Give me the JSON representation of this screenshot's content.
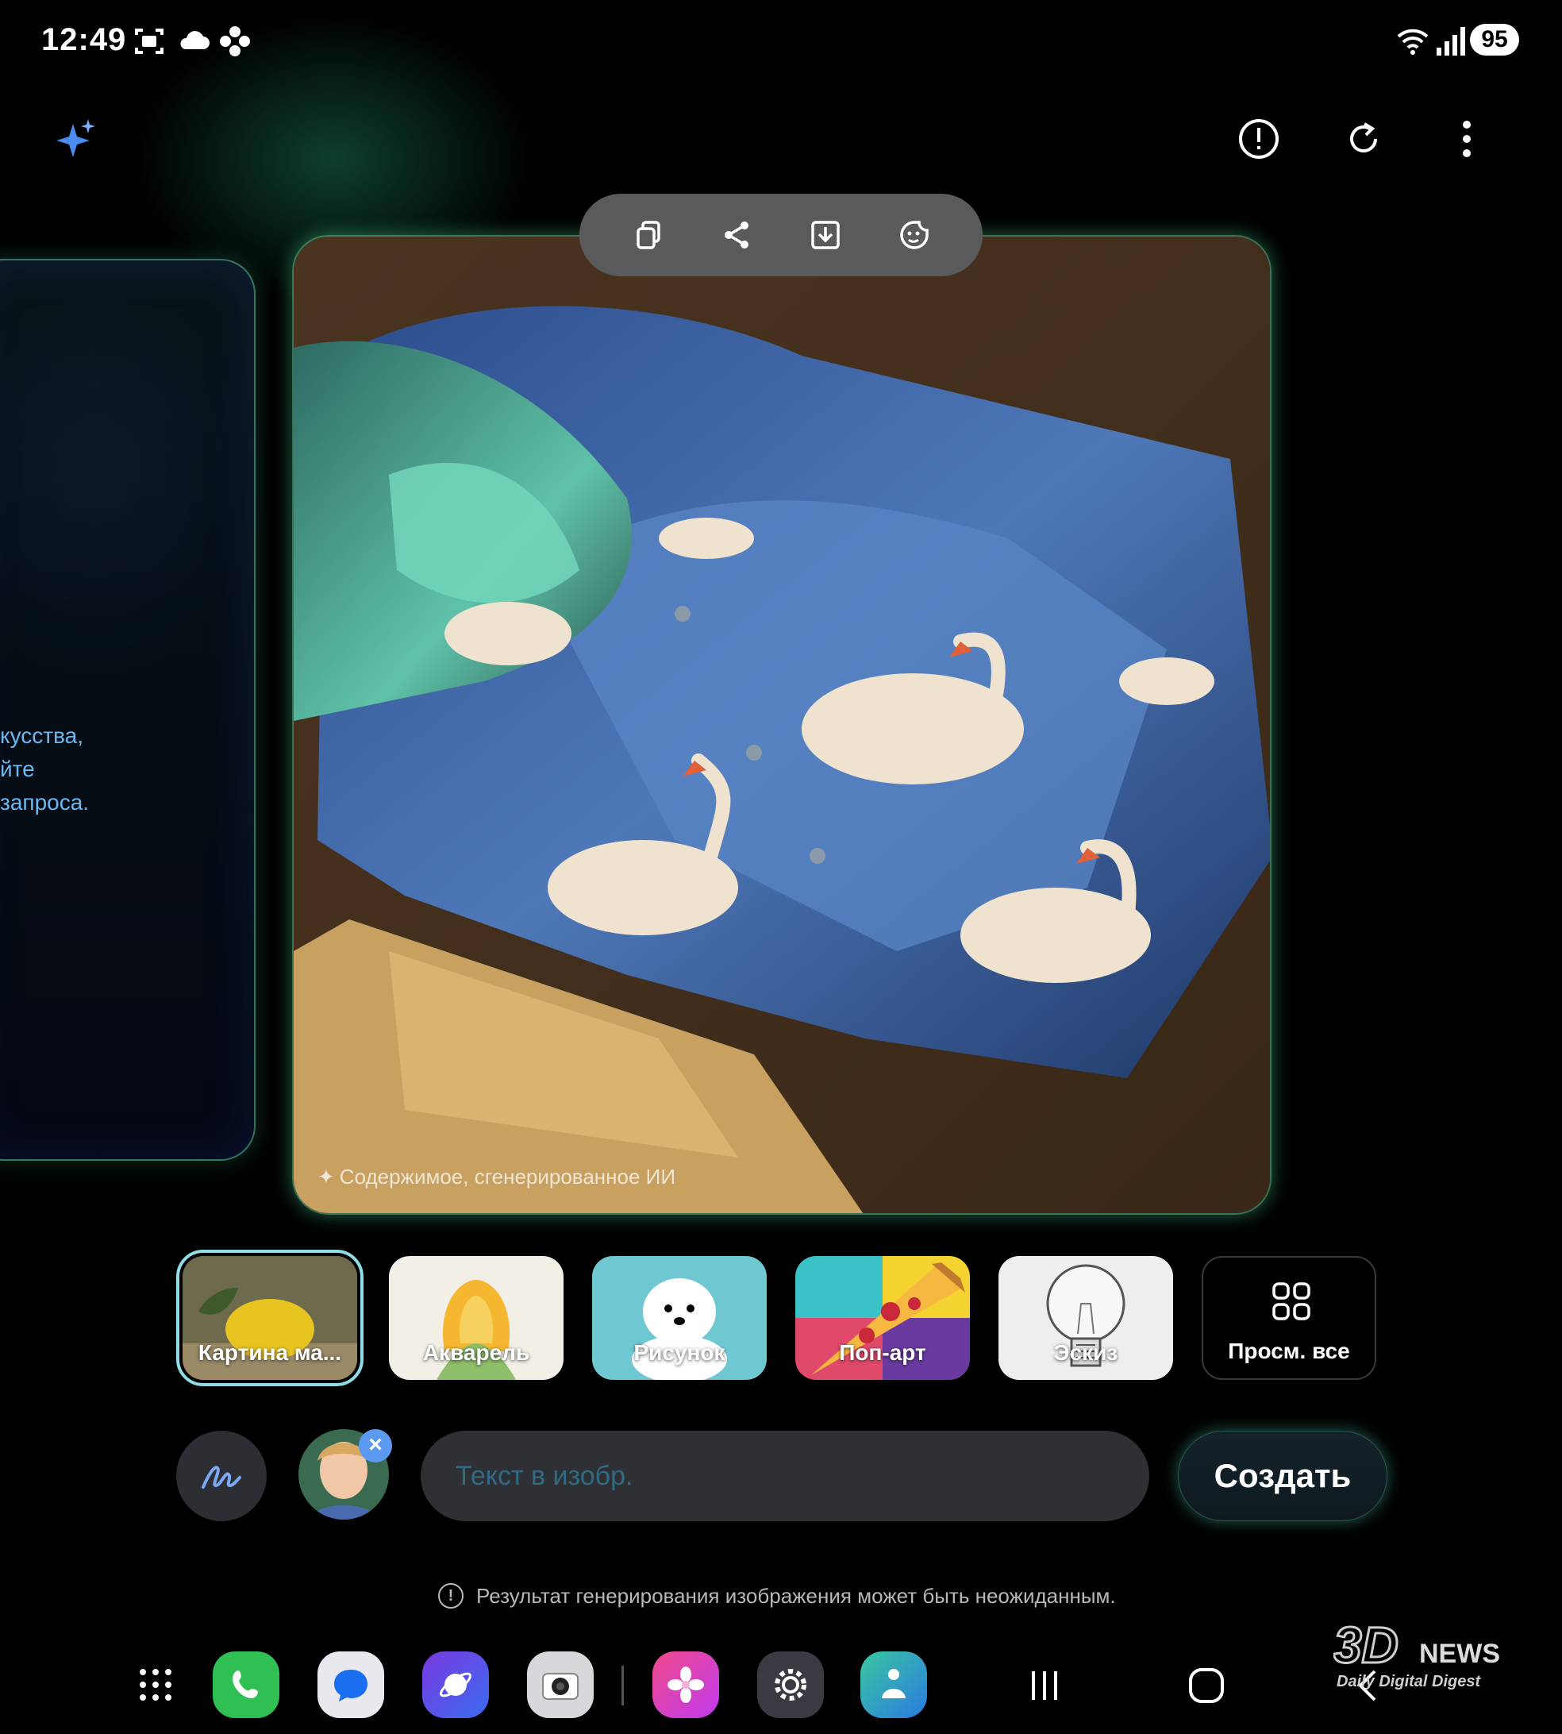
{
  "status_bar": {
    "time": "12:49",
    "battery": "95"
  },
  "left_card": {
    "lines": [
      "кусства,",
      "йте",
      "запроса."
    ]
  },
  "image": {
    "watermark": "Содержимое, сгенерированное ИИ"
  },
  "styles": [
    {
      "label": "Картина ма..."
    },
    {
      "label": "Акварель"
    },
    {
      "label": "Рисунок"
    },
    {
      "label": "Поп-арт"
    },
    {
      "label": "Эскиз"
    },
    {
      "label": "Просм. все"
    }
  ],
  "input": {
    "placeholder": "Текст в изобр."
  },
  "create_button": "Создать",
  "disclaimer": "Результат генерирования изображения может быть неожиданным.",
  "logo": {
    "main": "3D",
    "sub": "NEWS",
    "tagline": "Daily Digital Digest"
  },
  "colors": {
    "accent_glow": "#5ad6a0",
    "left_text": "#69b8f2",
    "selected_outline": "#8fdde6",
    "badge": "#5b9af0"
  }
}
